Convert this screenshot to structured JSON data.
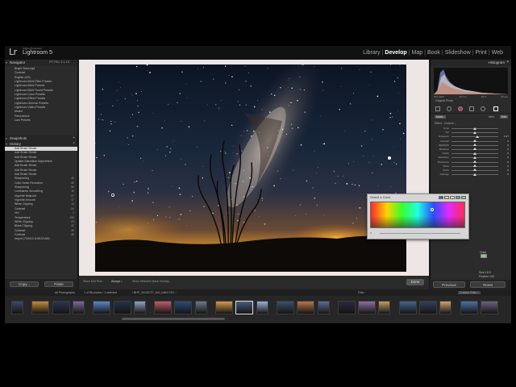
{
  "app": {
    "brand_small": "Adobe Photoshop",
    "brand": "Lightroom 5",
    "logo": "Lr",
    "modules": [
      "Library",
      "Develop",
      "Map",
      "Book",
      "Slideshow",
      "Print",
      "Web"
    ],
    "active_module": "Develop"
  },
  "left_panel": {
    "navigator": {
      "title": "Navigator",
      "zoom": "FIT  FILL  1:1  1:3"
    },
    "presets": [
      "Bright Skies.lrtpl",
      "Contrast",
      "English (US)",
      "Lightroom B&W Filter Presets",
      "Lightroom B&W Presets",
      "Lightroom B&W Toned Presets",
      "Lightroom Color Presets",
      "Lightroom Effect Presets",
      "Lightroom General Presets",
      "Lightroom Video Presets",
      "Muted",
      "Panoramics",
      "Lam Presets"
    ],
    "snapshots_title": "Snapshots",
    "history_title": "History",
    "history": [
      {
        "label": "Add Brush Stroke",
        "value": ""
      },
      {
        "label": "Add Brush Stroke",
        "value": ""
      },
      {
        "label": "Add Brush Stroke",
        "value": ""
      },
      {
        "label": "Update Saturation Adjustment",
        "value": ""
      },
      {
        "label": "Add Brush Stroke",
        "value": ""
      },
      {
        "label": "Add Brush Stroke",
        "value": ""
      },
      {
        "label": "Add Brush Stroke",
        "value": ""
      },
      {
        "label": "Sharpening",
        "value": "40"
      },
      {
        "label": "Color Noise Reduction",
        "value": "35"
      },
      {
        "label": "Sharpening",
        "value": "56"
      },
      {
        "label": "Luminance Smoothing",
        "value": "15"
      },
      {
        "label": "Vignette Midpoint",
        "value": "-27"
      },
      {
        "label": "Vignette Amount",
        "value": "17"
      },
      {
        "label": "White Clipping",
        "value": "14"
      },
      {
        "label": "Contrast",
        "value": "-24"
      },
      {
        "label": "Vivi",
        "value": "2"
      },
      {
        "label": "Temperature",
        "value": "100"
      },
      {
        "label": "White Clipping",
        "value": "23"
      },
      {
        "label": "Black Clipping",
        "value": "42"
      },
      {
        "label": "Contrast",
        "value": "49"
      },
      {
        "label": "Contrast",
        "value": "48"
      },
      {
        "label": "Import (7/26/13 6:08:03 AM)",
        "value": ""
      }
    ],
    "copy_label": "Copy...",
    "paste_label": "Paste"
  },
  "toolbar": {
    "show_edit_pins": "Show Edit Pins :",
    "show_edit_pins_value": "Always ↕",
    "overlay_checkbox": "Show Selected Mask Overlay",
    "done_label": "Done"
  },
  "right_panel": {
    "histogram_title": "Histogram",
    "histo_info": [
      "ISO 3200",
      "15 mm",
      "f/2.8",
      "30 sec"
    ],
    "original_photo": "Original Photo",
    "mask": {
      "mask_label": "Mask :",
      "new": "New",
      "edit": "Edit"
    },
    "effect": "Effect :  Custom ↕",
    "sliders": [
      {
        "label": "Temp",
        "value": "",
        "pos": 0.5
      },
      {
        "label": "Tint",
        "value": "",
        "pos": 0.5
      },
      {
        "label": "Exposure",
        "value": "0.27",
        "pos": 0.55
      },
      {
        "label": "Contrast",
        "value": "0",
        "pos": 0.5
      },
      {
        "label": "Highlights",
        "value": "0",
        "pos": 0.5
      },
      {
        "label": "Shadows",
        "value": "0",
        "pos": 0.5
      },
      {
        "label": "Clarity",
        "value": "0",
        "pos": 0.5
      },
      {
        "label": "Saturation",
        "value": "0",
        "pos": 0.5
      },
      {
        "label": "Sharpness",
        "value": "0",
        "pos": 0.5
      },
      {
        "label": "Noise",
        "value": "0",
        "pos": 0.5
      },
      {
        "label": "Moire",
        "value": "0",
        "pos": 0.5
      },
      {
        "label": "Defringe",
        "value": "0",
        "pos": 0.5
      }
    ],
    "color_label": "Color",
    "size_values": [
      "Size  16.0",
      "Feather  100",
      "Flow  100",
      "Density  100"
    ],
    "basic_title": "Basic",
    "treatment": "Treatment :",
    "treatment_color": "Color",
    "treatment_bw": "Black & White",
    "previous_label": "Previous",
    "reset_label": "Reset"
  },
  "picker": {
    "title": "Select a Color",
    "sat_label": "S",
    "swatch_colors": [
      "#4b5bd6",
      "#e8d35a",
      "#d8d8d8",
      "#6f97c8",
      "#7dd07a"
    ]
  },
  "filmstrip": {
    "source": "All Photographs",
    "count": "1 of 86 photos / 1 selected",
    "filename": "/ BHP_20130727_000_0483.CR2 ↕",
    "filter_label": "Filter :",
    "custom_filter": "Custom Filter ↕"
  },
  "colors": {
    "accent": "#ffffff",
    "panel": "#2b2b2b",
    "canvas": "#ede6e5"
  }
}
